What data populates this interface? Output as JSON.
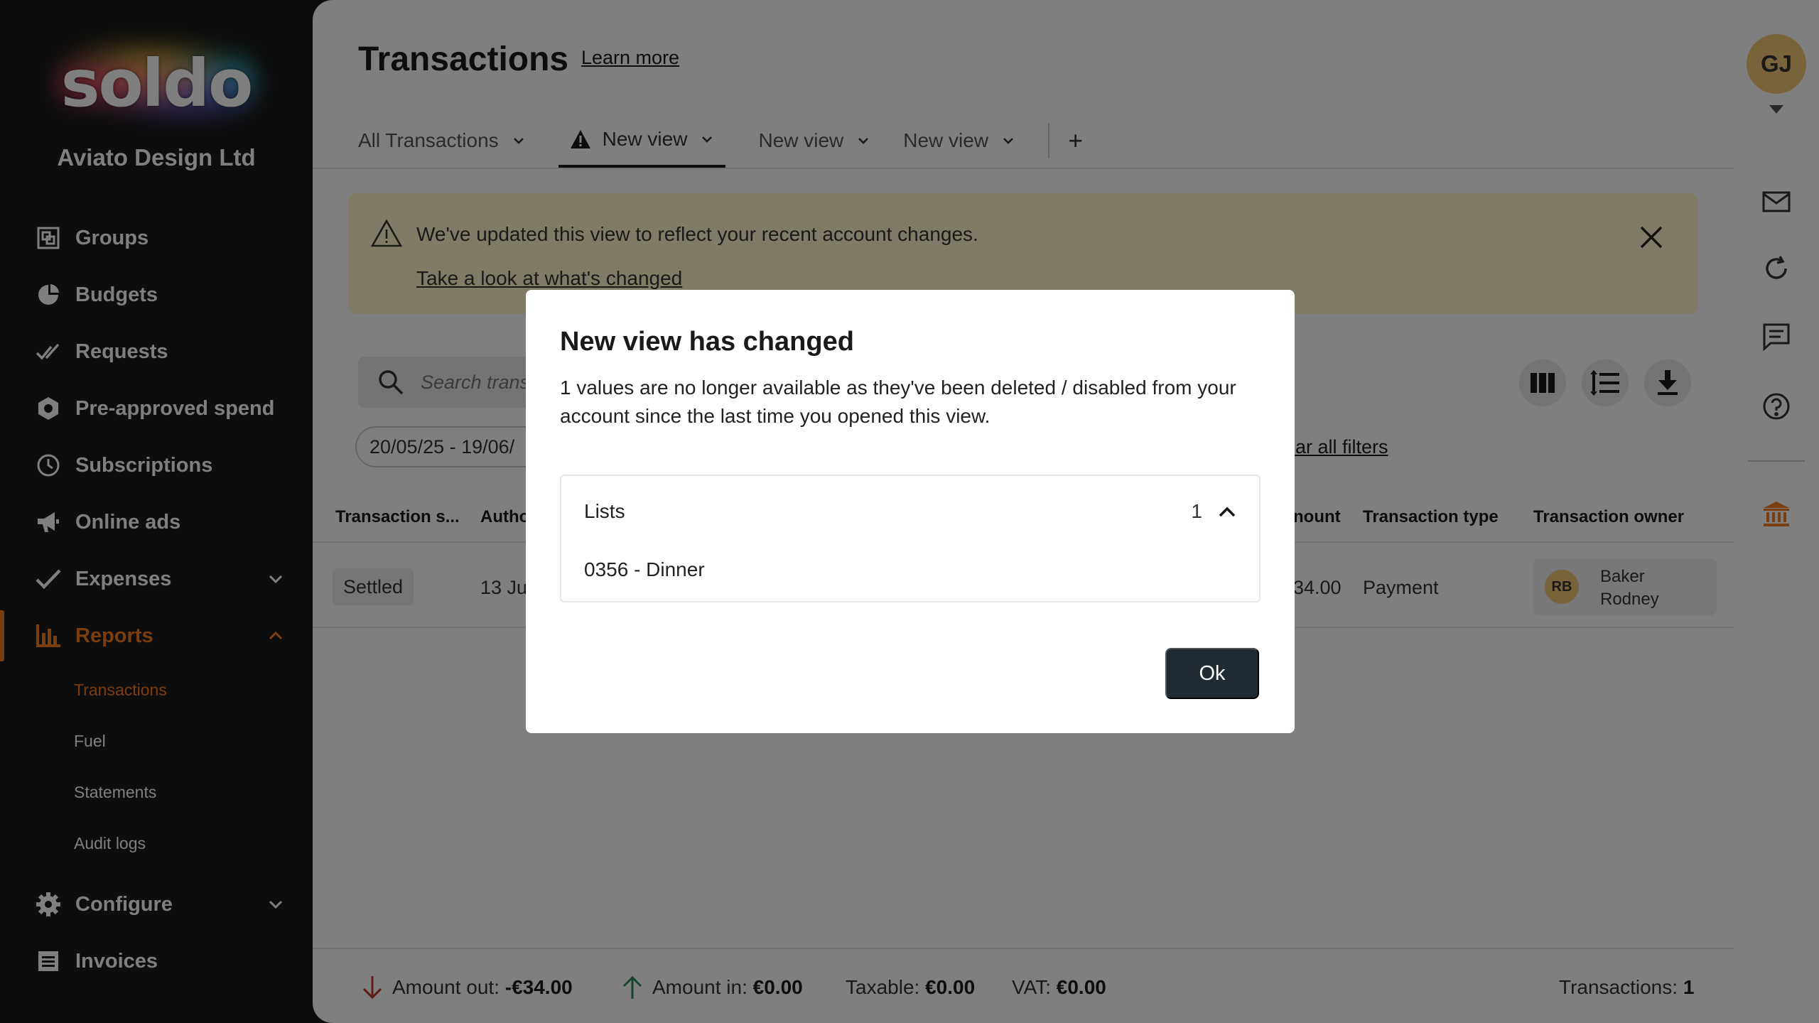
{
  "brand": {
    "logo_text": "soldo",
    "company": "Aviato Design Ltd"
  },
  "sidebar": {
    "items": [
      {
        "label": "Groups",
        "icon": "groups-icon"
      },
      {
        "label": "Budgets",
        "icon": "budgets-icon"
      },
      {
        "label": "Requests",
        "icon": "requests-icon"
      },
      {
        "label": "Pre-approved spend",
        "icon": "pre-approved-icon"
      },
      {
        "label": "Subscriptions",
        "icon": "clock-icon"
      },
      {
        "label": "Online ads",
        "icon": "megaphone-icon"
      },
      {
        "label": "Expenses",
        "icon": "check-icon"
      },
      {
        "label": "Reports",
        "icon": "bar-chart-icon"
      },
      {
        "label": "Configure",
        "icon": "gear-icon"
      },
      {
        "label": "Invoices",
        "icon": "invoice-icon"
      }
    ],
    "reports_sub": [
      "Transactions",
      "Fuel",
      "Statements",
      "Audit logs"
    ],
    "accent_color": "#f57a1a"
  },
  "header": {
    "title": "Transactions",
    "learn_more": "Learn more"
  },
  "tabs": [
    {
      "label": "All Transactions"
    },
    {
      "label": "New view",
      "active": true,
      "warning": true
    },
    {
      "label": "New view"
    },
    {
      "label": "New view"
    }
  ],
  "tab_add": "+",
  "notice": {
    "text": "We've updated this view to reflect your recent account changes.",
    "link": "Take a look at what's changed"
  },
  "search": {
    "placeholder": "Search trans"
  },
  "filters": {
    "date": "20/05/25 - 19/06/",
    "clear": "ear all filters"
  },
  "table": {
    "headers": [
      "Transaction s...",
      "Autho",
      "nount",
      "Transaction type",
      "Transaction owner"
    ],
    "rows": [
      {
        "status": "Settled",
        "auth_date": "13 Ju",
        "amount": "34.00",
        "type": "Payment",
        "owner_initials": "RB",
        "owner_name": "Baker Rodney"
      }
    ]
  },
  "footer": {
    "amount_out_label": "Amount out:",
    "amount_out": "-€34.00",
    "amount_in_label": "Amount in:",
    "amount_in": "€0.00",
    "taxable_label": "Taxable:",
    "taxable": "€0.00",
    "vat_label": "VAT:",
    "vat": "€0.00",
    "count_label": "Transactions:",
    "count": "1"
  },
  "rail": {
    "avatar": "GJ",
    "icons": [
      "mail-icon",
      "refresh-icon",
      "chat-icon",
      "help-icon",
      "bank-icon"
    ]
  },
  "modal": {
    "title": "New view has changed",
    "body": "1 values are no longer available as they've been deleted / disabled from your account since the last time you opened this view.",
    "list_title": "Lists",
    "list_count": "1",
    "list_item": "0356 - Dinner",
    "ok": "Ok"
  }
}
